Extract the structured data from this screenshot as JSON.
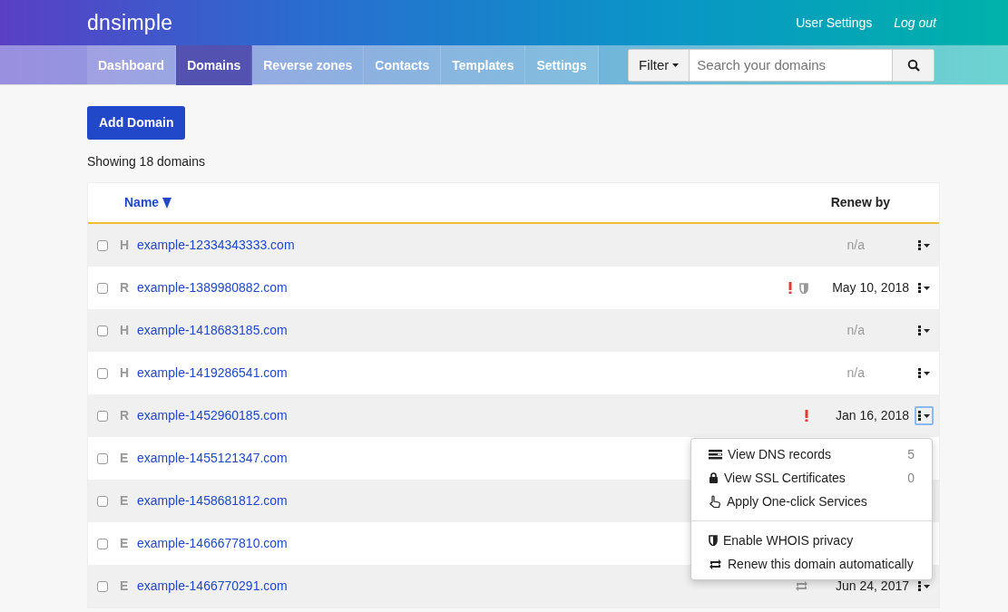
{
  "header": {
    "logo": "dnsimple",
    "links": [
      {
        "label": "User Settings",
        "italic": false
      },
      {
        "label": "Log out",
        "italic": true
      }
    ]
  },
  "nav": {
    "tabs": [
      {
        "label": "Dashboard",
        "selected": false
      },
      {
        "label": "Domains",
        "selected": true
      },
      {
        "label": "Reverse zones",
        "selected": false
      },
      {
        "label": "Contacts",
        "selected": false
      },
      {
        "label": "Templates",
        "selected": false
      },
      {
        "label": "Settings",
        "selected": false
      }
    ],
    "filter": "Filter",
    "search": {
      "placeholder": "Search your domains"
    }
  },
  "add_button": "Add Domain",
  "summary": "Showing 18 domains",
  "table": {
    "columns": [
      {
        "label": "Name",
        "sorted": true
      },
      {
        "label": "Renew by",
        "sorted": false
      }
    ],
    "rows": [
      {
        "type": "H",
        "name": "example-12334343333.com",
        "checked": false,
        "warning": false,
        "whois_privacy": false,
        "auto_renew": false,
        "renew": "n/a",
        "renew_set": false,
        "menu_open": false
      },
      {
        "type": "R",
        "name": "example-1389980882.com",
        "checked": false,
        "warning": true,
        "whois_privacy": true,
        "auto_renew": false,
        "renew": "May 10, 2018",
        "renew_set": true,
        "menu_open": false
      },
      {
        "type": "H",
        "name": "example-1418683185.com",
        "checked": false,
        "warning": false,
        "whois_privacy": false,
        "auto_renew": false,
        "renew": "n/a",
        "renew_set": false,
        "menu_open": false
      },
      {
        "type": "H",
        "name": "example-1419286541.com",
        "checked": false,
        "warning": false,
        "whois_privacy": false,
        "auto_renew": false,
        "renew": "n/a",
        "renew_set": false,
        "menu_open": false
      },
      {
        "type": "R",
        "name": "example-1452960185.com",
        "checked": false,
        "warning": true,
        "whois_privacy": false,
        "auto_renew": false,
        "renew": "Jan 16, 2018",
        "renew_set": true,
        "menu_open": true
      },
      {
        "type": "E",
        "name": "example-1455121347.com",
        "checked": false
      },
      {
        "type": "E",
        "name": "example-1458681812.com",
        "checked": false
      },
      {
        "type": "E",
        "name": "example-1466677810.com",
        "checked": false
      },
      {
        "type": "E",
        "name": "example-1466770291.com",
        "checked": false,
        "warning": false,
        "whois_privacy": false,
        "auto_renew": true,
        "renew": "Jun 24, 2017",
        "renew_set": true,
        "menu_open": false
      }
    ]
  },
  "menu": {
    "groups": [
      [
        {
          "kind": "records",
          "label": "View DNS records",
          "count": "5"
        },
        {
          "kind": "lock",
          "label": "View SSL Certificates",
          "count": "0"
        },
        {
          "kind": "hand",
          "label": "Apply One-click Services"
        }
      ],
      [
        {
          "kind": "whois",
          "label": "Enable WHOIS privacy"
        },
        {
          "kind": "autorenew",
          "label": "Renew this domain automatically"
        }
      ]
    ]
  }
}
